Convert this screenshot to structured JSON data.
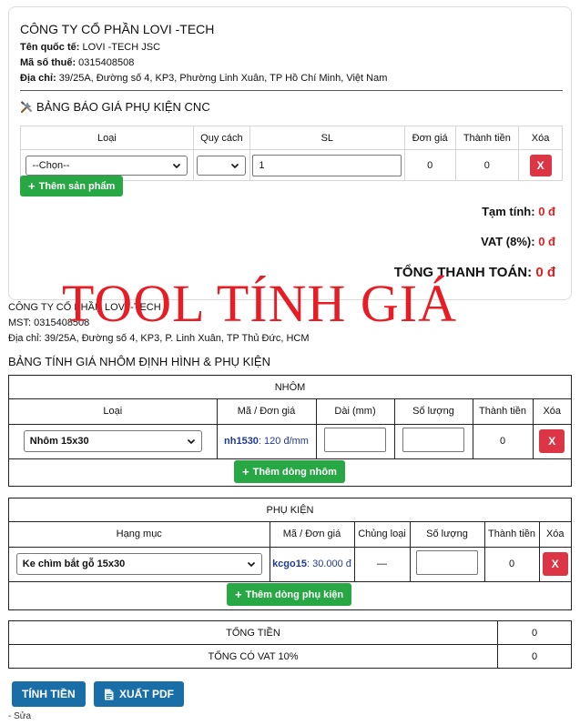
{
  "quote": {
    "company_name": "CÔNG TY CỔ PHẦN LOVI -TECH",
    "intl_label": "Tên quốc tế:",
    "intl_value": " LOVI -TECH JSC",
    "tax_label": "Mã số thuế:",
    "tax_value": " 0315408508",
    "addr_label": "Địa chỉ:",
    "addr_value": " 39/25A, Đường số 4, KP3, Phường Linh Xuân, TP Hồ Chí Minh, Việt Nam",
    "section_title": "BẢNG BÁO GIÁ PHỤ KIỆN CNC",
    "section_icon": "tools-icon",
    "columns": [
      "Loại",
      "Quy cách",
      "SL",
      "Đơn giá",
      "Thành tiền",
      "Xóa"
    ],
    "row": {
      "type": "--Chọn--",
      "spec": "",
      "qty": "1",
      "unit_price": "0",
      "total": "0",
      "delete": "X"
    },
    "add_button": "Thêm sản phẩm",
    "subtotal_label": "Tạm tính:",
    "subtotal_value": "0 đ",
    "vat_label": "VAT (8%):",
    "vat_value": "0 đ",
    "grand_label": "TỔNG THANH TOÁN:",
    "grand_value": "0 đ"
  },
  "watermark": "TOOL TÍNH GIÁ",
  "calc": {
    "company_name": "CÔNG TY CỔ PHẦN LOVI -TECH",
    "mst": "MST: 0315408508",
    "address": "Địa chỉ: 39/25A, Đường số 4, KP3, P. Linh Xuân, TP Thủ Đức, HCM",
    "title": "BẢNG TÍNH GIÁ NHÔM ĐỊNH HÌNH & PHỤ KIỆN",
    "aluminum": {
      "header": "NHÔM",
      "columns": [
        "Loại",
        "Mã / Đơn giá",
        "Dài (mm)",
        "Số lượng",
        "Thành tiền",
        "Xóa"
      ],
      "row": {
        "type": "Nhôm 15x30",
        "code": "nh1530",
        "price": ": 120 đ/mm",
        "length": "",
        "qty": "",
        "total": "0",
        "delete": "X"
      },
      "add_button": "Thêm dòng nhôm"
    },
    "accessories": {
      "header": "PHỤ KIỆN",
      "columns": [
        "Hạng mục",
        "Mã / Đơn giá",
        "Chủng loại",
        "Số lượng",
        "Thành tiền",
        "Xóa"
      ],
      "row": {
        "item": "Ke chìm bắt gỗ 15x30",
        "code": "kcgo15",
        "price": ": 30.000 đ",
        "kind": "—",
        "qty": "",
        "total": "0",
        "delete": "X"
      },
      "add_button": "Thêm dòng phụ kiện"
    },
    "totals": [
      {
        "label": "TỔNG TIỀN",
        "value": "0"
      },
      {
        "label": "TỔNG CÓ VAT 10%",
        "value": "0"
      }
    ],
    "calc_button": "TÍNH TIỀN",
    "pdf_button": "XUẤT PDF",
    "pdf_icon": "document-icon",
    "footer": "- Sửa"
  },
  "colors": {
    "green": "#28a745",
    "red": "#dc3545",
    "blue": "#1a6ea8",
    "watermark": "#e81c24"
  }
}
